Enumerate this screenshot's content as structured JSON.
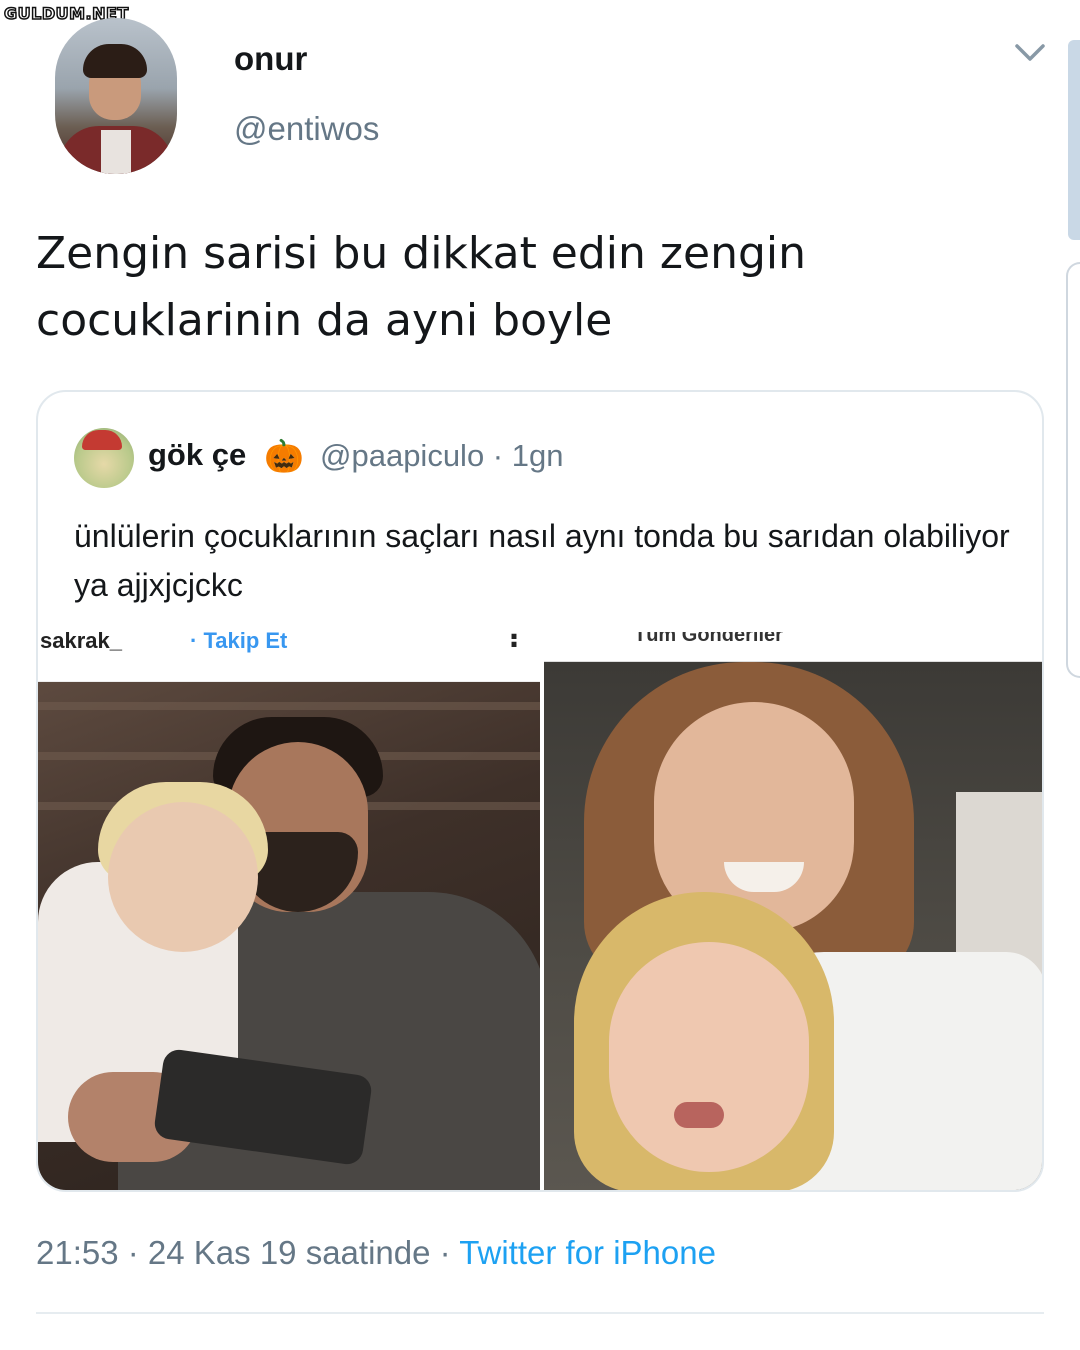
{
  "watermark": "GULDUM.NET",
  "author": {
    "name": "onur",
    "handle": "@entiwos"
  },
  "tweet": {
    "text": "Zengin sarisi bu dikkat edin zengin cocuklarinin da ayni boyle"
  },
  "quoted_tweet": {
    "name": "gök çe",
    "emoji": "🎃",
    "handle_time": "@paapiculo · 1gn",
    "text": "ünlülerin çocuklarının saçları nasıl aynı tonda bu sarıdan olabiliyor ya ajjxjcjckc",
    "photo_left_overlay": {
      "username": "sakrak_",
      "follow": "· Takip Et",
      "menu": "⋮"
    },
    "photo_right_overlay": {
      "tab": "Tüm Gönderiler"
    }
  },
  "footer": {
    "time_date": "21:53 · 24 Kas 19 saatinde · ",
    "source": "Twitter for iPhone"
  },
  "colors": {
    "secondary_text": "#657786",
    "link": "#1da1f2",
    "border": "#e1e8ed"
  },
  "icons": {
    "chevron": "chevron-down-icon"
  }
}
